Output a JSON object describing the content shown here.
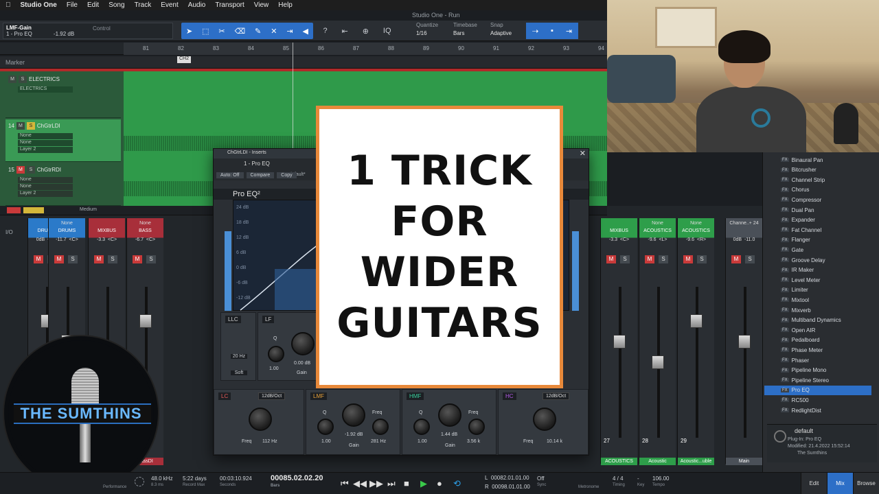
{
  "menubar": {
    "apple": "",
    "app": "Studio One",
    "items": [
      "File",
      "Edit",
      "Song",
      "Track",
      "Event",
      "Audio",
      "Transport",
      "View",
      "Help"
    ]
  },
  "window_title": "Studio One - Run",
  "track_info": {
    "name": "LMF-Gain",
    "plugin": "1 - Pro EQ",
    "value": "-1.92 dB",
    "control": "Control"
  },
  "toolbar": {
    "quantize": {
      "label": "Quantize",
      "value": "1/16"
    },
    "timebase": {
      "label": "Timebase",
      "value": "Bars"
    },
    "snap": {
      "label": "Snap",
      "value": "Adaptive"
    },
    "iq": "IQ"
  },
  "ruler": [
    "81",
    "82",
    "83",
    "84",
    "85",
    "86",
    "87",
    "88",
    "89",
    "90",
    "91",
    "92",
    "93",
    "94"
  ],
  "marker": {
    "label": "Marker",
    "ch2": "CH2"
  },
  "tracks": [
    {
      "num": "",
      "name": "ELECTRICS",
      "sub1": "ELECTRICS"
    },
    {
      "num": "14",
      "name": "ChGtrLDI",
      "sub1": "None",
      "sub2": "None",
      "sub3": "Layer 2"
    },
    {
      "num": "15",
      "name": "ChGtrRDI",
      "sub1": "None",
      "sub2": "None",
      "sub3": "Layer 2"
    }
  ],
  "mixer_bar": {
    "medium": "Medium",
    "io": "I/O"
  },
  "channels": [
    {
      "top": "",
      "name": "DRUMS",
      "vol": "0dB",
      "pan": "<C>",
      "num": "",
      "foot": "",
      "color": "#2b7ac9"
    },
    {
      "top": "None",
      "name": "DRUMS",
      "vol": "-11.7",
      "pan": "<C>",
      "num": "",
      "foot": "",
      "color": "#2b7ac9"
    },
    {
      "top": "",
      "name": "MIXBUS",
      "vol": "-3.3",
      "pan": "<C>",
      "num": "",
      "foot": "",
      "color": "#a82f3a"
    },
    {
      "top": "None",
      "name": "BASS",
      "vol": "-6.7",
      "pan": "<C>",
      "num": "18",
      "foot": "BassDI",
      "color": "#a82f3a"
    },
    {
      "top": "",
      "name": "MIXBUS",
      "vol": "-3.3",
      "pan": "<C>",
      "num": "27",
      "foot": "ACOUSTICS",
      "color": "#2e9e4a"
    },
    {
      "top": "None",
      "name": "ACOUSTICS",
      "vol": "-9.6",
      "pan": "<L>",
      "num": "28",
      "foot": "Acoustic",
      "color": "#2e9e4a"
    },
    {
      "top": "None",
      "name": "ACOUSTICS",
      "vol": "-9.6",
      "pan": "<R>",
      "num": "29",
      "foot": "Acoustic...uble",
      "color": "#2e9e4a"
    },
    {
      "top": "Channe..+ 24",
      "name": "",
      "vol": "0dB",
      "pan": "-11.0",
      "num": "",
      "foot": "Main",
      "color": "#4a5058"
    }
  ],
  "plugin": {
    "title": "ChGtrLDI - Inserts",
    "preset": "1 - Pro EQ",
    "default_name": "default*",
    "auto": "Auto: Off",
    "compare": "Compare",
    "copy": "Copy",
    "name": "Pro EQ²",
    "bands": {
      "llc": {
        "label": "LLC",
        "freq": "20 Hz",
        "soft": "Soft"
      },
      "lf": {
        "label": "LF",
        "q": "1.00",
        "gain": "0.00 dB"
      },
      "lc": {
        "label": "LC",
        "slope": "12dB/Oct",
        "freq": "112 Hz"
      },
      "lmf": {
        "label": "LMF",
        "q": "1.00",
        "gain": "-1.92 dB",
        "freq": "281 Hz"
      },
      "hmf": {
        "label": "HMF",
        "q": "1.00",
        "gain": "1.44 dB",
        "freq": "3.56 k"
      },
      "hc": {
        "label": "HC",
        "slope": "12dB/Oct",
        "freq": "10.14 k"
      }
    },
    "labels": {
      "q": "Q",
      "gain": "Gain",
      "freq": "Freq"
    },
    "db_scale": [
      "24 dB",
      "18 dB",
      "12 dB",
      "6 dB",
      "0 dB",
      "-6 dB",
      "-12 dB"
    ]
  },
  "thumbnail": {
    "lines": [
      "1 TRICK",
      "FOR",
      "WIDER",
      "GUITARS"
    ]
  },
  "logo": {
    "text": "THE SUMTHINS"
  },
  "browser": {
    "items": [
      "Binaural Pan",
      "Bitcrusher",
      "Channel Strip",
      "Chorus",
      "Compressor",
      "Dual Pan",
      "Expander",
      "Fat Channel",
      "Flanger",
      "Gate",
      "Groove Delay",
      "IR Maker",
      "Level Meter",
      "Limiter",
      "Mixtool",
      "Mixverb",
      "Multiband Dynamics",
      "Open AIR",
      "Pedalboard",
      "Phase Meter",
      "Phaser",
      "Pipeline Mono",
      "Pipeline Stereo",
      "Pro EQ",
      "RC500",
      "RedlightDist"
    ],
    "selected": "Pro EQ",
    "fx_tag": "FX",
    "info": {
      "title": "default",
      "plugin": "Plug-In:  Pro EQ",
      "modified": "Modified:  21.4.2022 15:52:14",
      "author": "The Sumthins"
    }
  },
  "transport": {
    "sample_rate": "48.0 kHz",
    "latency": "8.3 ms",
    "record_max": "5:22 days",
    "record_max_label": "Record Max",
    "seconds": "00:03:10.924",
    "seconds_label": "Seconds",
    "bars": "00085.02.02.20",
    "bars_label": "Bars",
    "loop_l": "00082.01.01.00",
    "loop_r": "00098.01.01.00",
    "sync": "Off",
    "sync_label": "Sync",
    "metronome_label": "Metronome",
    "timing": "4 / 4",
    "timing_label": "Timing",
    "key": "-",
    "key_label": "Key",
    "tempo": "106.00",
    "tempo_label": "Tempo",
    "performance_label": "Performance",
    "edit": "Edit",
    "mix": "Mix",
    "browse": "Browse"
  }
}
